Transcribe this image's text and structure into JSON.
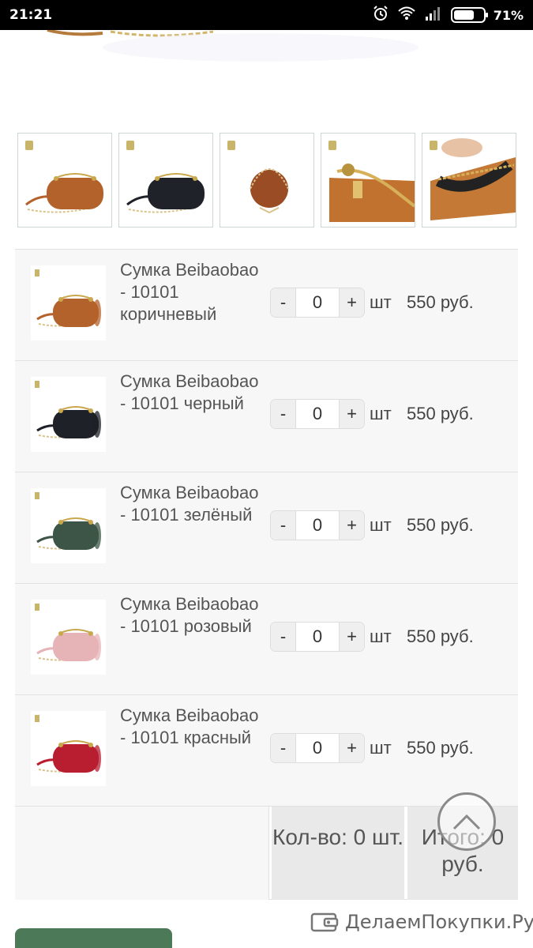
{
  "status_bar": {
    "time": "21:21",
    "battery": "71%",
    "battery_level": 0.71
  },
  "colors": {
    "accent_button": "#4c7a58",
    "row_bg": "#f7f7f7",
    "summary_bg": "#e9e9e9"
  },
  "thumbnails": [
    {
      "alt": "brown bag",
      "color": "#b4622b"
    },
    {
      "alt": "black bag",
      "color": "#1f2228"
    },
    {
      "alt": "brown bag side",
      "color": "#9a4c24"
    },
    {
      "alt": "zipper detail",
      "color": "#c2722f"
    },
    {
      "alt": "bag interior",
      "color": "#c47a36"
    }
  ],
  "products": [
    {
      "name": "Сумка Beibaobao - 10101 коричневый",
      "qty": "0",
      "unit": "шт",
      "price": "550 руб.",
      "color": "#b4622b"
    },
    {
      "name": "Сумка Beibaobao - 10101 черный",
      "qty": "0",
      "unit": "шт",
      "price": "550 руб.",
      "color": "#1e2127"
    },
    {
      "name": "Сумка Beibaobao - 10101 зелёный",
      "qty": "0",
      "unit": "шт",
      "price": "550 руб.",
      "color": "#3c5546"
    },
    {
      "name": "Сумка Beibaobao - 10101 розовый",
      "qty": "0",
      "unit": "шт",
      "price": "550 руб.",
      "color": "#e6b3b6"
    },
    {
      "name": "Сумка Beibaobao - 10101 красный",
      "qty": "0",
      "unit": "шт",
      "price": "550 руб.",
      "color": "#b81d30"
    }
  ],
  "summary": {
    "count": "Кол-во: 0 шт.",
    "total": "Итого: 0 руб."
  },
  "watermark": {
    "text": "ДелаемПокупки.Ру"
  },
  "controls": {
    "minus": "-",
    "plus": "+"
  }
}
